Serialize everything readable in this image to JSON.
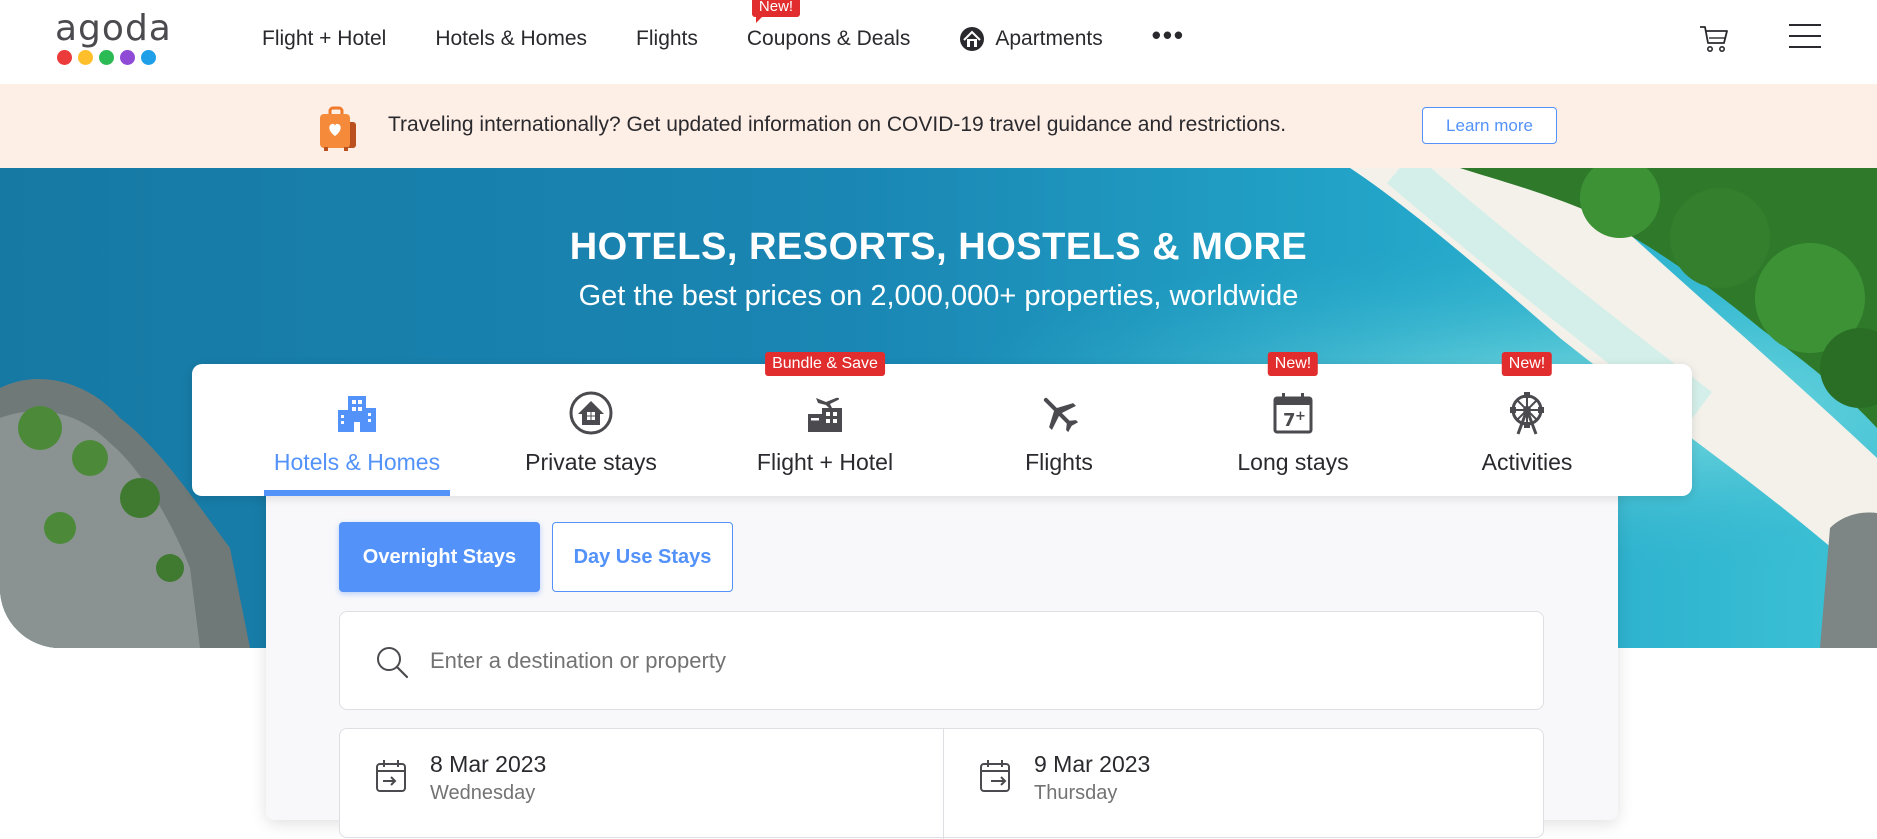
{
  "brand": {
    "name": "agoda",
    "dot_colors": [
      "#ec3b3b",
      "#ffbf2b",
      "#2bba54",
      "#8f4ad6",
      "#1f9fe8"
    ]
  },
  "nav": {
    "items": [
      {
        "label": "Flight + Hotel"
      },
      {
        "label": "Hotels & Homes"
      },
      {
        "label": "Flights"
      },
      {
        "label": "Coupons & Deals",
        "badge": "New!"
      },
      {
        "label": "Apartments",
        "icon": "apartment-home-icon"
      }
    ],
    "more_label": "•••",
    "icons": [
      "cart-icon",
      "hamburger-menu-icon"
    ]
  },
  "banner": {
    "text": "Traveling internationally? Get updated information on COVID-19 travel guidance and restrictions.",
    "button_label": "Learn more",
    "icon": "luggage-heart-icon"
  },
  "hero": {
    "title": "HOTELS, RESORTS, HOSTELS & MORE",
    "subtitle": "Get the best prices on 2,000,000+ properties, worldwide"
  },
  "tabs": [
    {
      "label": "Hotels & Homes",
      "icon": "hotel-building-icon",
      "active": true,
      "badge": ""
    },
    {
      "label": "Private stays",
      "icon": "private-home-icon",
      "active": false,
      "badge": ""
    },
    {
      "label": "Flight + Hotel",
      "icon": "flight-hotel-icon",
      "active": false,
      "badge": "Bundle & Save"
    },
    {
      "label": "Flights",
      "icon": "airplane-icon",
      "active": false,
      "badge": ""
    },
    {
      "label": "Long stays",
      "icon": "calendar-seven-plus-icon",
      "active": false,
      "badge": "New!"
    },
    {
      "label": "Activities",
      "icon": "ferris-wheel-icon",
      "active": false,
      "badge": "New!"
    }
  ],
  "stay_type": {
    "overnight_label": "Overnight Stays",
    "dayuse_label": "Day Use Stays",
    "selected": "Overnight Stays"
  },
  "search": {
    "placeholder": "Enter a destination or property",
    "value": ""
  },
  "dates": {
    "checkin": {
      "date": "8 Mar 2023",
      "weekday": "Wednesday"
    },
    "checkout": {
      "date": "9 Mar 2023",
      "weekday": "Thursday"
    }
  },
  "colors": {
    "accent": "#5392f9",
    "badge_red": "#e12d2d",
    "banner_bg": "#fdeee6"
  }
}
